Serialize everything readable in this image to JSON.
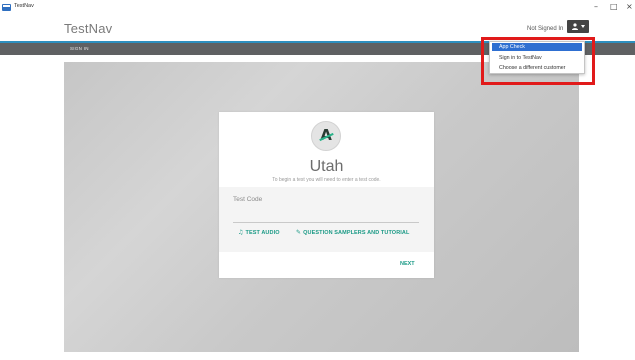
{
  "window": {
    "title": "TestNav",
    "controls": {
      "minimize": "–",
      "maximize": "□",
      "close": "×"
    }
  },
  "header": {
    "brand": "TestNav",
    "signed_status": "Not Signed In",
    "user_icon": "user-icon"
  },
  "navbar": {
    "sign_in": "SIGN IN",
    "accent_color": "#2d8fbf"
  },
  "card": {
    "state_name": "Utah",
    "instructions": "To begin a test you will need to enter a test code.",
    "code_placeholder": "Test Code",
    "test_audio": "TEST AUDIO",
    "samplers": "QUESTION SAMPLERS AND TUTORIAL",
    "next": "NEXT",
    "accent_color": "#1b9a86"
  },
  "dropdown": {
    "items": [
      {
        "label": "App Check",
        "selected": true
      },
      {
        "label": "Sign in to TestNav",
        "selected": false
      },
      {
        "label": "Choose a different customer",
        "selected": false
      }
    ],
    "highlight_color": "#e11a1a"
  }
}
